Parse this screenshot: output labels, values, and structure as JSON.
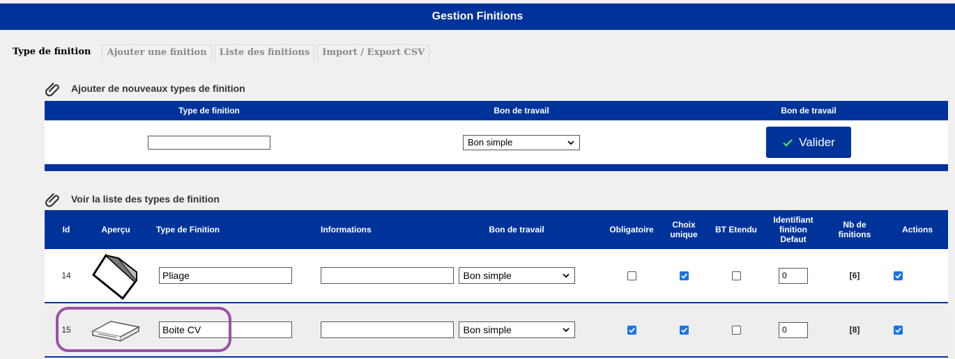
{
  "header": {
    "title": "Gestion Finitions"
  },
  "tabs": [
    "Type de finition",
    "Ajouter une finition",
    "Liste des finitions",
    "Import / Export CSV"
  ],
  "add_section": {
    "title": "Ajouter de nouveaux types de finition",
    "columns": [
      "Type de finition",
      "Bon de travail",
      "Bon de travail"
    ],
    "type_input_value": "",
    "bon_select_value": "Bon simple",
    "submit_label": "Valider"
  },
  "list_section": {
    "title": "Voir la liste des types de finition",
    "columns": {
      "id": "Id",
      "apercu": "Aperçu",
      "type": "Type de Finition",
      "informations": "Informations",
      "bon": "Bon de travail",
      "obligatoire": "Obligatoire",
      "choix": "Choix unique",
      "bt": "BT Etendu",
      "ident": "Identifiant finition Defaut",
      "nb": "Nb de finitions",
      "actions": "Actions"
    },
    "rows": [
      {
        "id": "14",
        "preview_icon": "folded-sheet-icon",
        "type": "Pliage",
        "informations": "",
        "bon": "Bon simple",
        "obligatoire": false,
        "choix_unique": true,
        "bt_etendu": false,
        "ident": "0",
        "nb": "[6]",
        "actions": true
      },
      {
        "id": "15",
        "preview_icon": "box-icon",
        "type": "Boite CV",
        "informations": "",
        "bon": "Bon simple",
        "obligatoire": true,
        "choix_unique": true,
        "bt_etendu": false,
        "ident": "0",
        "nb": "[8]",
        "actions": true
      }
    ]
  },
  "colors": {
    "primary": "#003399",
    "checkbox": "#1a73e8",
    "highlight": "#9b4fa6",
    "row_alt": "#eeeeee"
  }
}
